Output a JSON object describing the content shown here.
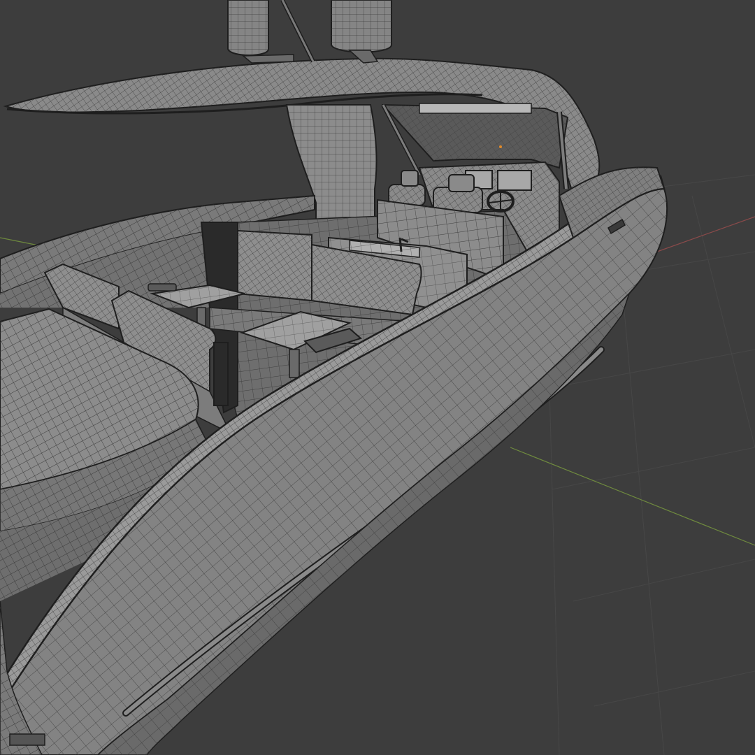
{
  "viewport": {
    "background_color": "#3d3d3d",
    "grid_color": "#484848",
    "axis_x_color": "#8a4a4a",
    "axis_y_color": "#6f8a3e",
    "mesh_fill": "#7f7f7f",
    "mesh_fill_light": "#8c8c8c",
    "mesh_fill_dark": "#5f5f5f",
    "wire_color": "#3a3a3a",
    "edge_color": "#1e1e1e",
    "origin_dot_color": "#e08a2a",
    "display_mode": "wireframe-overlay"
  }
}
